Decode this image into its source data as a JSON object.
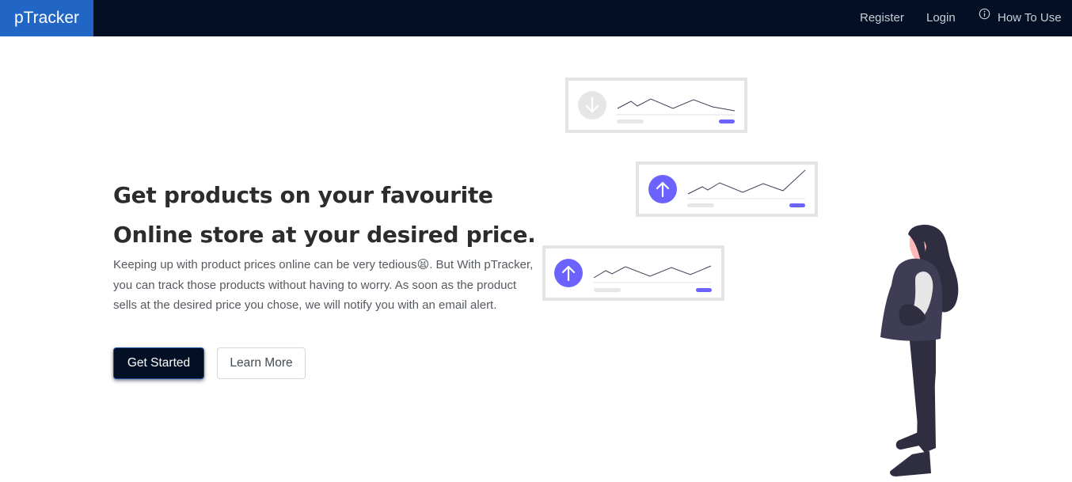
{
  "navbar": {
    "brand": "pTracker",
    "links": {
      "register": "Register",
      "login": "Login",
      "how_to_use": "How To Use"
    },
    "how_to_use_icon": "info-circle-icon"
  },
  "hero": {
    "title_line1": "Get products on your favourite",
    "title_line2": "Online store at your desired price.",
    "description": "Keeping up with product prices online can be very tedious😫. But With pTracker, you can track those products without having to worry. As soon as the product sells at the desired price you chose, we will notify you with an email alert.",
    "primary_button": "Get Started",
    "secondary_button": "Learn More"
  },
  "illustration": {
    "cards": [
      {
        "trend": "down",
        "icon": "arrow-down-icon"
      },
      {
        "trend": "up",
        "icon": "arrow-up-icon"
      },
      {
        "trend": "up",
        "icon": "arrow-up-icon"
      }
    ],
    "figure": "woman-standing-illustration"
  },
  "colors": {
    "navbar_bg": "#020f24",
    "brand_bg": "#2166c4",
    "accent": "#6c63ff",
    "primary_button_bg": "#020f24"
  }
}
